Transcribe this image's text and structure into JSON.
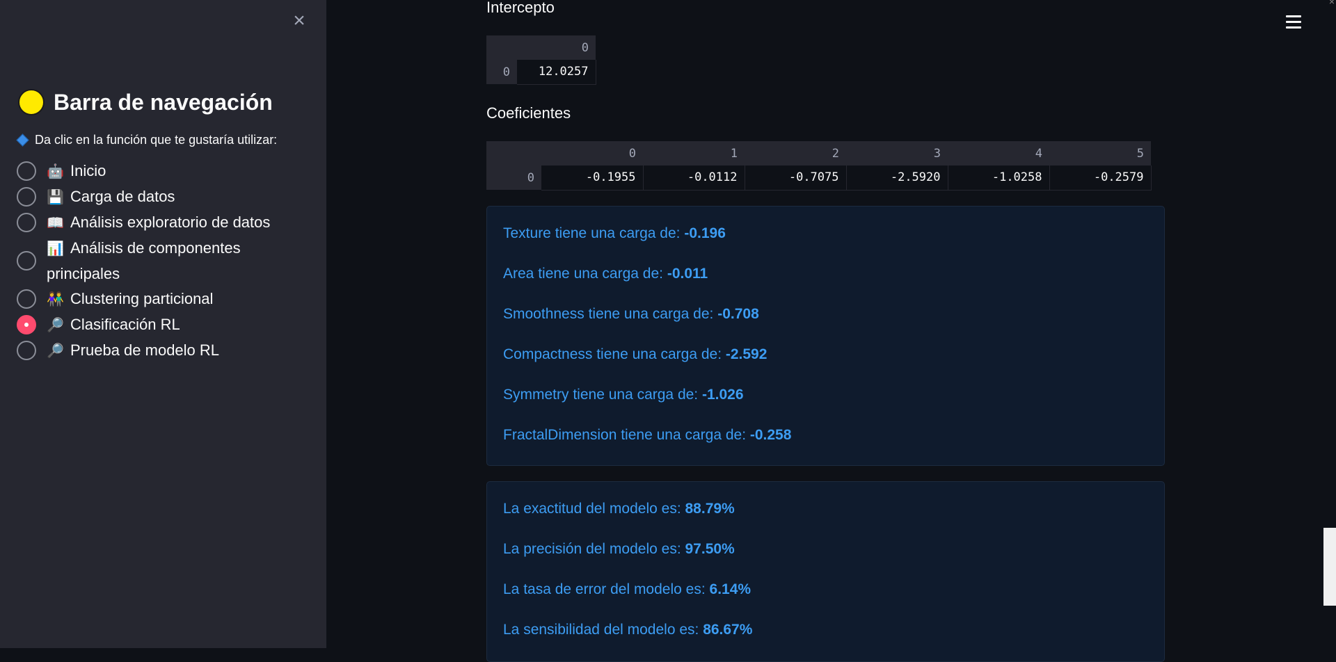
{
  "sidebar": {
    "close_label": "×",
    "title": "Barra de navegación",
    "prompt": "Da clic en la función que te gustaría utilizar:",
    "items": [
      {
        "icon": "robot-icon",
        "icon_glyph": "🤖",
        "label": "Inicio",
        "selected": false
      },
      {
        "icon": "floppy-disk-icon",
        "icon_glyph": "💾",
        "label": "Carga de datos",
        "selected": false
      },
      {
        "icon": "open-book-icon",
        "icon_glyph": "📖",
        "label": "Análisis exploratorio de datos",
        "selected": false
      },
      {
        "icon": "bar-chart-icon",
        "icon_glyph": "📊",
        "label": "Análisis de componentes principales",
        "selected": false
      },
      {
        "icon": "people-icon",
        "icon_glyph": "👫",
        "label": "Clustering particional",
        "selected": false
      },
      {
        "icon": "magnifier-icon",
        "icon_glyph": "🔎",
        "label": "Clasificación RL",
        "selected": true
      },
      {
        "icon": "magnifier-icon",
        "icon_glyph": "🔎",
        "label": "Prueba de modelo RL",
        "selected": false
      }
    ]
  },
  "main": {
    "intercept": {
      "label": "Intercepto",
      "columns": [
        "0"
      ],
      "rows": [
        {
          "index": "0",
          "values": [
            "12.0257"
          ]
        }
      ]
    },
    "coefficients": {
      "label": "Coeficientes",
      "columns": [
        "0",
        "1",
        "2",
        "3",
        "4",
        "5"
      ],
      "rows": [
        {
          "index": "0",
          "values": [
            "-0.1955",
            "-0.0112",
            "-0.7075",
            "-2.5920",
            "-1.0258",
            "-0.2579"
          ]
        }
      ]
    },
    "loadings": [
      {
        "text": "Texture tiene una carga de: ",
        "value": "-0.196"
      },
      {
        "text": "Area tiene una carga de: ",
        "value": "-0.011"
      },
      {
        "text": "Smoothness tiene una carga de: ",
        "value": "-0.708"
      },
      {
        "text": "Compactness tiene una carga de: ",
        "value": "-2.592"
      },
      {
        "text": "Symmetry tiene una carga de: ",
        "value": "-1.026"
      },
      {
        "text": "FractalDimension tiene una carga de: ",
        "value": "-0.258"
      }
    ],
    "metrics": [
      {
        "text": "La exactitud del modelo es: ",
        "value": "88.79%"
      },
      {
        "text": "La precisión del modelo es: ",
        "value": "97.50%"
      },
      {
        "text": "La tasa de error del modelo es: ",
        "value": "6.14%"
      },
      {
        "text": "La sensibilidad del modelo es: ",
        "value": "86.67%"
      }
    ]
  },
  "colors": {
    "sidebar_bg": "#262730",
    "main_bg": "#0e1117",
    "accent": "#ff4b6e",
    "info_text": "#3d9df3",
    "info_bg": "#0f1b2d"
  }
}
